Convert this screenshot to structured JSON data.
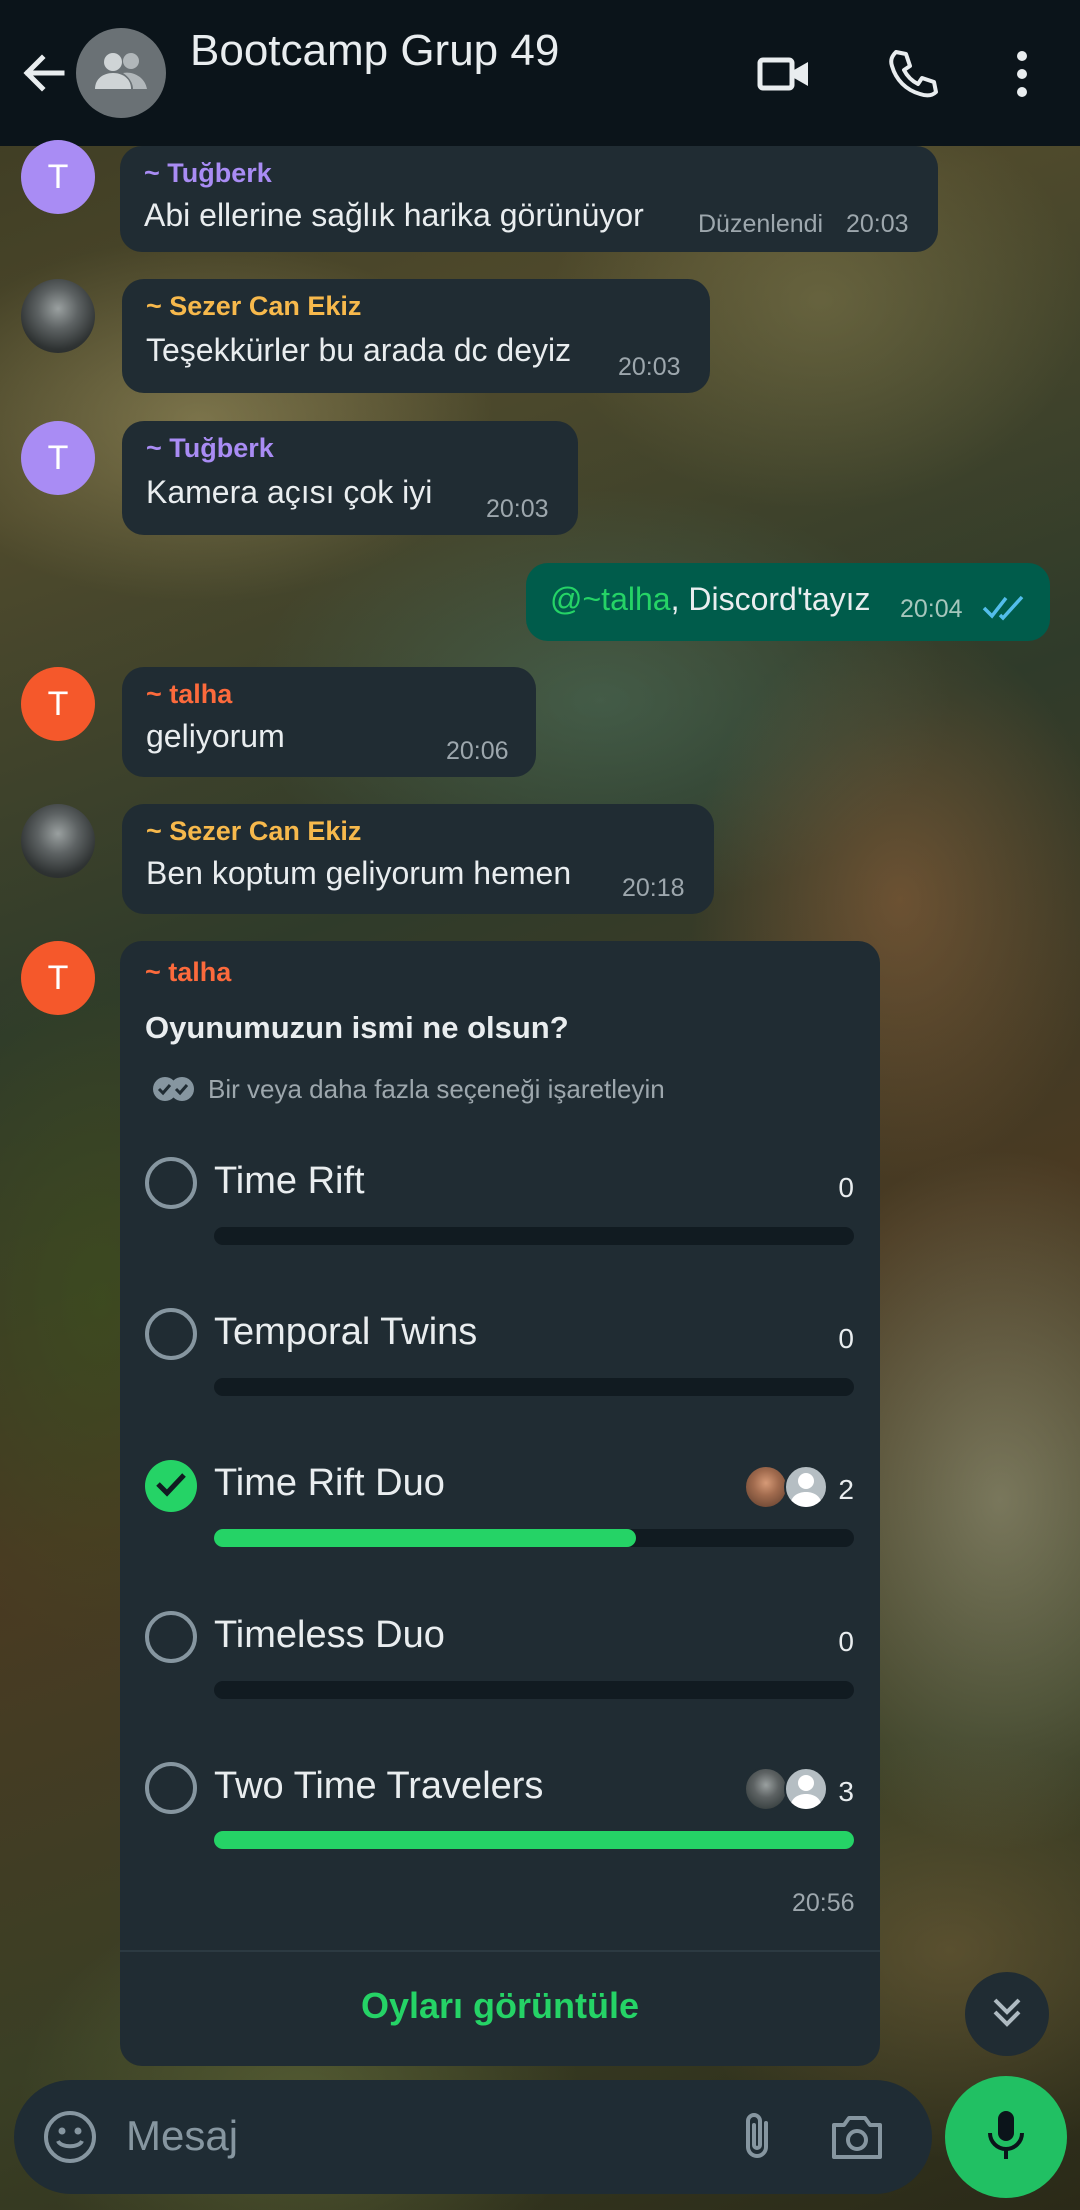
{
  "header": {
    "title": "Bootcamp Grup 49",
    "back_icon": "arrow-left-icon",
    "avatar_icon": "group-icon",
    "actions": [
      "video-call-icon",
      "voice-call-icon",
      "more-vert-icon"
    ]
  },
  "messages": [
    {
      "sender": "~ Tuğberk",
      "avatar_letter": "T",
      "text": "Abi ellerine sağlık harika görünüyor",
      "edited": "Düzenlendi",
      "time": "20:03"
    },
    {
      "sender": "~ Sezer Can Ekiz",
      "text": "Teşekkürler bu arada dc deyiz",
      "time": "20:03"
    },
    {
      "sender": "~ Tuğberk",
      "avatar_letter": "T",
      "text": "Kamera açısı çok iyi",
      "time": "20:03"
    },
    {
      "outgoing": true,
      "mention": "@~talha",
      "text": ", Discord'tayız",
      "time": "20:04"
    },
    {
      "sender": "~ talha",
      "avatar_letter": "T",
      "text": "geliyorum",
      "time": "20:06"
    },
    {
      "sender": "~ Sezer Can Ekiz",
      "text": "Ben koptum geliyorum hemen",
      "time": "20:18"
    }
  ],
  "poll": {
    "sender": "~ talha",
    "avatar_letter": "T",
    "question": "Oyunumuzun ismi ne olsun?",
    "hint": "Bir veya daha fazla seçeneği işaretleyin",
    "options": [
      {
        "label": "Time Rift",
        "count": "0",
        "fraction": 0,
        "checked": false
      },
      {
        "label": "Temporal Twins",
        "count": "0",
        "fraction": 0,
        "checked": false
      },
      {
        "label": "Time Rift Duo",
        "count": "2",
        "fraction": 0.66,
        "checked": true
      },
      {
        "label": "Timeless Duo",
        "count": "0",
        "fraction": 0,
        "checked": false
      },
      {
        "label": "Two Time Travelers",
        "count": "3",
        "fraction": 1.0,
        "checked": false
      }
    ],
    "time": "20:56",
    "view_votes": "Oyları görüntüle"
  },
  "composer": {
    "placeholder": "Mesaj",
    "icons": [
      "emoji-icon",
      "attach-icon",
      "camera-icon",
      "mic-icon"
    ]
  },
  "colors": {
    "accent": "#25d366",
    "header_bg": "#0b141a",
    "bubble_in": "#202c33",
    "bubble_out": "#005c4b",
    "sender_purple": "#a98cf4",
    "sender_gold": "#f7b94c",
    "sender_orange": "#fc6a3c"
  }
}
